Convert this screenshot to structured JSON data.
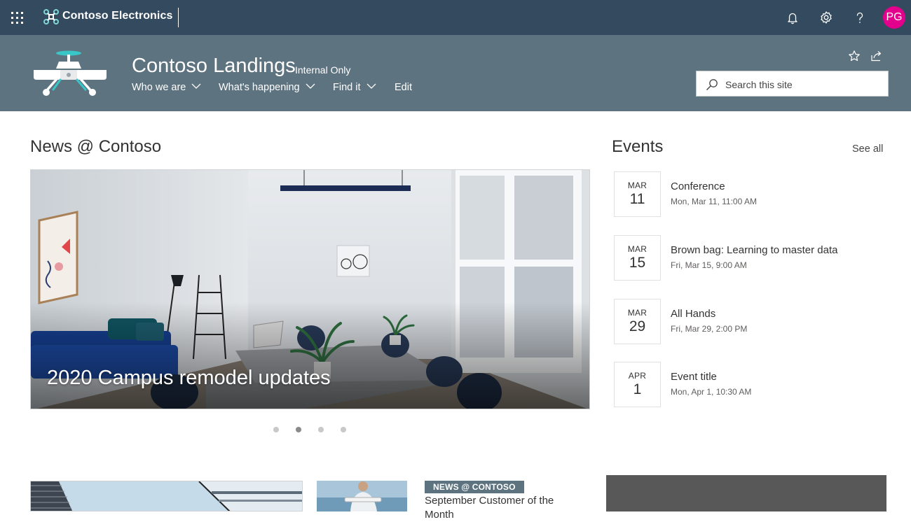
{
  "suite_bar": {
    "app_name": "Contoso Electronics",
    "avatar_initials": "PG",
    "icons": [
      "app-launcher-icon",
      "bell-icon",
      "gear-icon",
      "help-icon"
    ]
  },
  "site_header": {
    "title": "Contoso Landings",
    "badge": "Internal Only",
    "nav": [
      {
        "label": "Who we are"
      },
      {
        "label": "What's happening"
      },
      {
        "label": "Find it"
      },
      {
        "label": "Edit"
      }
    ],
    "search_placeholder": "Search this site"
  },
  "news": {
    "title": "News @ Contoso",
    "hero_caption": "2020 Campus remodel updates",
    "active_slide": 2,
    "slide_count": 4,
    "secondary": {
      "tag": "NEWS @ CONTOSO",
      "headline": "September Customer of the Month"
    }
  },
  "events": {
    "title": "Events",
    "see_all": "See all",
    "items": [
      {
        "month": "MAR",
        "day": "11",
        "name": "Conference",
        "when": "Mon, Mar 11, 11:00 AM"
      },
      {
        "month": "MAR",
        "day": "15",
        "name": "Brown bag: Learning to master data",
        "when": "Fri, Mar 15, 9:00 AM"
      },
      {
        "month": "MAR",
        "day": "29",
        "name": "All Hands",
        "when": "Fri, Mar 29, 2:00 PM"
      },
      {
        "month": "APR",
        "day": "1",
        "name": "Event title",
        "when": "Mon, Apr 1, 10:30 AM"
      }
    ]
  },
  "colors": {
    "suite_bar": "#344a5e",
    "site_header": "#5e7380",
    "avatar": "#e3008c",
    "accent_teal": "#33b5b5"
  }
}
